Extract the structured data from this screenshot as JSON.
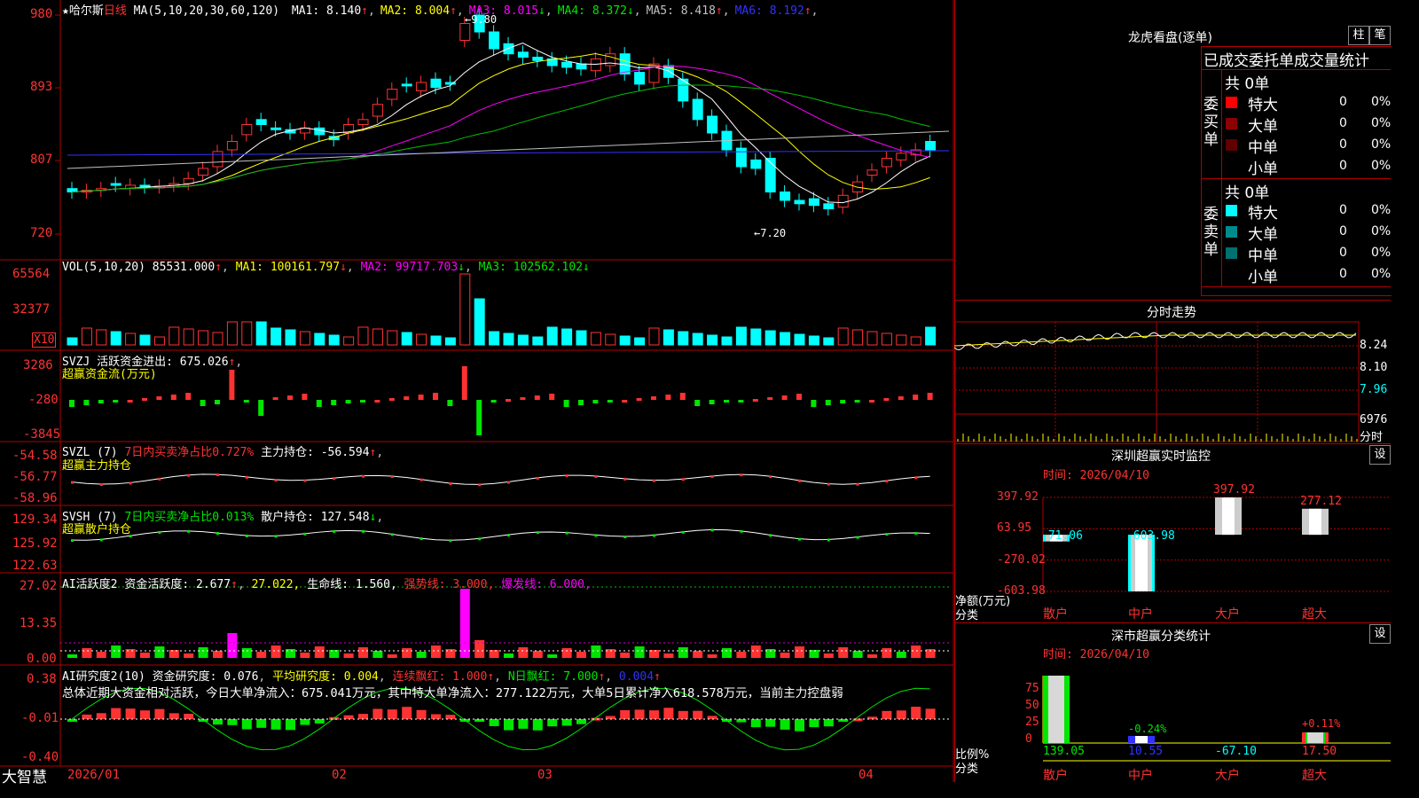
{
  "app": {
    "logo": "大智慧",
    "stock": "★哈尔斯",
    "period": "日线"
  },
  "main_chart": {
    "ma_label": "MA(5,10,20,30,60,120)",
    "ma_items": [
      {
        "label": "MA1:",
        "value": "8.140",
        "arrow": "↑",
        "color": "#ffffff"
      },
      {
        "label": "MA2:",
        "value": "8.004",
        "arrow": "↑",
        "color": "#ffff00"
      },
      {
        "label": "MA3:",
        "value": "8.015",
        "arrow": "↓",
        "color": "#ff00ff"
      },
      {
        "label": "MA4:",
        "value": "8.372",
        "arrow": "↓",
        "color": "#00e600"
      },
      {
        "label": "MA5:",
        "value": "8.418",
        "arrow": "↑",
        "color": "#c0c0c0"
      },
      {
        "label": "MA6:",
        "value": "8.192",
        "arrow": "↑",
        "color": "#3232ff"
      }
    ],
    "high_mark": "←9.80",
    "low_mark": "←7.20",
    "y_ticks": [
      "980",
      "893",
      "807",
      "720"
    ]
  },
  "vol_panel": {
    "label": "VOL(5,10,20)",
    "value": "85531.000",
    "ma1": "MA1: 100161.797",
    "ma2": "MA2: 99717.703",
    "ma3": "MA3: 102562.102",
    "y_ticks": [
      "65564",
      "32377"
    ],
    "unit": "X10"
  },
  "svzj_panel": {
    "label": "SVZJ",
    "text": "活跃资金进出: 675.026",
    "subtitle": "超赢资金流(万元)",
    "y_ticks": [
      "3286",
      "-280",
      "-3845"
    ]
  },
  "svzl_panel": {
    "label": "SVZL (7)",
    "pct": "7日内买卖净占比0.727%",
    "text": "主力持仓: -56.594",
    "subtitle": "超赢主力持仓",
    "y_ticks": [
      "-54.58",
      "-56.77",
      "-58.96"
    ]
  },
  "svsh_panel": {
    "label": "SVSH (7)",
    "pct": "7日内买卖净占比0.013%",
    "text": "散户持仓: 127.548",
    "subtitle": "超赢散户持仓",
    "y_ticks": [
      "129.34",
      "125.92",
      "122.63"
    ]
  },
  "ai_active_panel": {
    "label": "AI活跃度2",
    "t1": "资金活跃度: 2.677",
    "t2": "27.022,",
    "t3": "生命线: 1.560,",
    "t4": "强势线: 3.000,",
    "t5": "爆发线: 6.000,",
    "y_ticks": [
      "27.02",
      "13.35",
      "0.00"
    ]
  },
  "ai_research_panel": {
    "label": "AI研究度2(10)",
    "t1": "资金研究度: 0.076",
    "t2": "平均研究度: 0.004",
    "t3": "连续飘红: 1.000",
    "t4": "N日飘红: 7.000",
    "t5": "0.004",
    "summary": "总体近期大资金相对活跃，今日大单净流入：675.041万元，其中特大单净流入：277.122万元，大单5日累计净入618.578万元，当前主力控盘弱",
    "y_ticks": [
      "0.38",
      "-0.01",
      "-0.40"
    ]
  },
  "x_axis": {
    "labels": [
      "2026/01",
      "02",
      "03",
      "04"
    ]
  },
  "dragon_tiger": {
    "title": "龙虎看盘(逐单)",
    "btn1": "柱",
    "btn2": "笔",
    "header": "已成交委托单成交量统计",
    "buy_label": "委买单",
    "sell_label": "委卖单",
    "buy_total": "共 0单",
    "sell_total": "共 0单",
    "buy_rows": [
      {
        "name": "特大",
        "count": "0",
        "pct": "0%",
        "color": "#ff0000"
      },
      {
        "name": "大单",
        "count": "0",
        "pct": "0%",
        "color": "#8b0000"
      },
      {
        "name": "中单",
        "count": "0",
        "pct": "0%",
        "color": "#600000"
      },
      {
        "name": "小单",
        "count": "0",
        "pct": "0%",
        "color": ""
      }
    ],
    "sell_rows": [
      {
        "name": "特大",
        "count": "0",
        "pct": "0%",
        "color": "#00ffff"
      },
      {
        "name": "大单",
        "count": "0",
        "pct": "0%",
        "color": "#008b8b"
      },
      {
        "name": "中单",
        "count": "0",
        "pct": "0%",
        "color": "#007070"
      },
      {
        "name": "小单",
        "count": "0",
        "pct": "0%",
        "color": ""
      }
    ]
  },
  "intraday": {
    "title": "分时走势",
    "y_ticks": [
      "8.24",
      "8.10",
      "7.96",
      "6976"
    ],
    "vol_label": "分时"
  },
  "sz_monitor": {
    "title": "深圳超赢实时监控",
    "btn": "设",
    "time": "时间: 2026/04/10",
    "y_ticks": [
      "397.92",
      "63.95",
      "-270.02",
      "-603.98"
    ],
    "y_label": "净额(万元)",
    "x_label": "分类",
    "categories": [
      "散户",
      "中户",
      "大户",
      "超大"
    ],
    "value_labels": [
      "-71.06",
      "-603.98",
      "397.92",
      "277.12"
    ]
  },
  "sz_classify": {
    "title": "深市超赢分类统计",
    "btn": "设",
    "time": "时间: 2026/04/10",
    "y_ticks": [
      "75",
      "50",
      "25",
      "0"
    ],
    "y_label": "比例%",
    "x_label": "分类",
    "categories": [
      "散户",
      "中户",
      "大户",
      "超大"
    ],
    "bar_labels": [
      "",
      "-0.24%",
      "",
      "+0.11%"
    ],
    "values": [
      "139.05",
      "10.55",
      "-67.10",
      "17.50"
    ]
  },
  "chart_data": {
    "type": "bar",
    "categories": [
      "散户",
      "中户",
      "大户",
      "超大"
    ],
    "values": [
      -71.06,
      -603.98,
      397.92,
      277.12
    ],
    "ylabel": "净额(万元)",
    "ylim": [
      -603.98,
      397.92
    ]
  }
}
